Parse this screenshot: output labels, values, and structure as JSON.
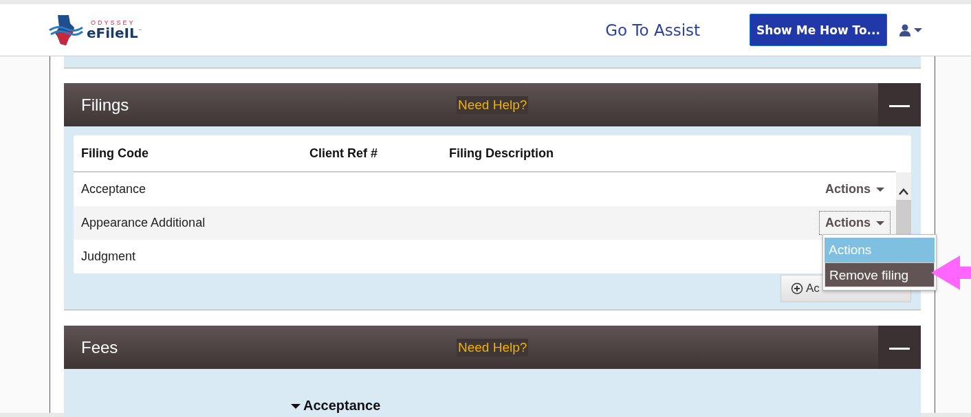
{
  "header": {
    "logo_top": "ODYSSEY",
    "logo_name": "eFileIL",
    "logo_mark": "™",
    "assist_link": "Go To Assist",
    "help_button": "Show Me How To..."
  },
  "filings": {
    "title": "Filings",
    "help": "Need Help?",
    "collapse_icon": "—",
    "columns": [
      "Filing Code",
      "Client Ref #",
      "Filing Description"
    ],
    "rows": [
      {
        "code": "Acceptance",
        "actions": "Actions",
        "focused": false
      },
      {
        "code": "Appearance Additional",
        "actions": "Actions",
        "focused": true
      },
      {
        "code": "Judgment",
        "actions": "",
        "focused": false
      }
    ],
    "menu": [
      {
        "label": "Actions",
        "selected": false
      },
      {
        "label": "Remove filing",
        "selected": true
      }
    ],
    "add_button": "Ac"
  },
  "fees": {
    "title": "Fees",
    "help": "Need Help?",
    "collapse_icon": "—",
    "first_item": "Acceptance"
  }
}
